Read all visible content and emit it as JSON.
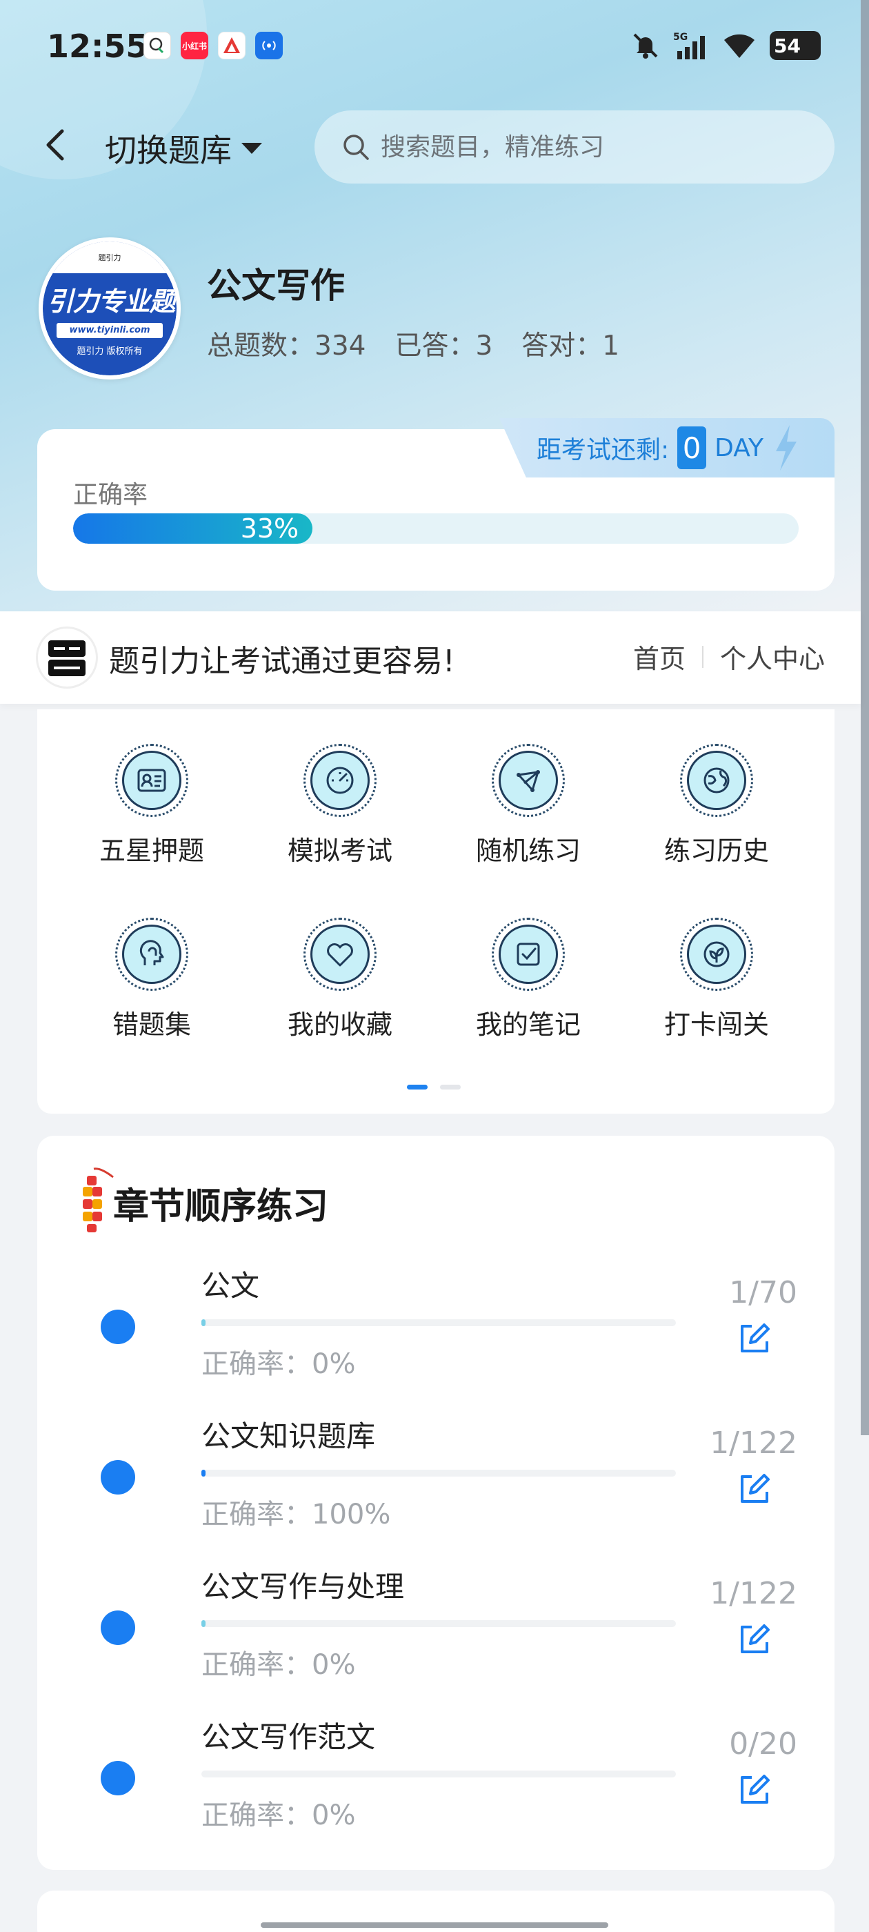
{
  "status_bar": {
    "time": "12:55",
    "battery": "54",
    "network": "5G",
    "app_icons": [
      "wallet-app",
      "xiaohongshu-app",
      "deliver-app",
      "nfc-app"
    ],
    "xhs_label": "小红书"
  },
  "header": {
    "switch_label": "切换题库",
    "search_placeholder": "搜索题目，精准练习"
  },
  "subject": {
    "title": "公文写作",
    "total_label": "总题数：334",
    "answered_label": "已答：3",
    "correct_label": "答对：1",
    "logo": {
      "top_text": "题引力",
      "main_text": "引力专业题",
      "url": "www.tiyinli.com",
      "copyright": "题引力 版权所有"
    }
  },
  "accuracy": {
    "label": "正确率",
    "value": 0.33,
    "value_text": "33%",
    "exam_prefix": "距考试还剩:",
    "exam_days": "0",
    "exam_unit": "DAY"
  },
  "promo": {
    "slogan": "题引力让考试通过更容易!",
    "link_home": "首页",
    "link_user": "个人中心"
  },
  "menu": {
    "items": [
      {
        "label": "五星押题",
        "icon": "id-card-icon"
      },
      {
        "label": "模拟考试",
        "icon": "speedometer-icon"
      },
      {
        "label": "随机练习",
        "icon": "network-icon"
      },
      {
        "label": "练习历史",
        "icon": "globe-icon"
      },
      {
        "label": "错题集",
        "icon": "head-icon"
      },
      {
        "label": "我的收藏",
        "icon": "heart-icon"
      },
      {
        "label": "我的笔记",
        "icon": "check-note-icon"
      },
      {
        "label": "打卡闯关",
        "icon": "leaf-badge-icon"
      }
    ],
    "page_count": 2,
    "active_page": 1
  },
  "chapters": {
    "title": "章节顺序练习",
    "items": [
      {
        "name": "公文",
        "accuracy": "正确率：0%",
        "count": "1/70"
      },
      {
        "name": "公文知识题库",
        "accuracy": "正确率：100%",
        "count": "1/122"
      },
      {
        "name": "公文写作与处理",
        "accuracy": "正确率：0%",
        "count": "1/122"
      },
      {
        "name": "公文写作范文",
        "accuracy": "正确率：0%",
        "count": "0/20"
      }
    ]
  },
  "colors": {
    "accent": "#1a7ef2",
    "progress_start": "#1677e8",
    "progress_end": "#19b7c7",
    "exam_text": "#1d7fd8"
  }
}
